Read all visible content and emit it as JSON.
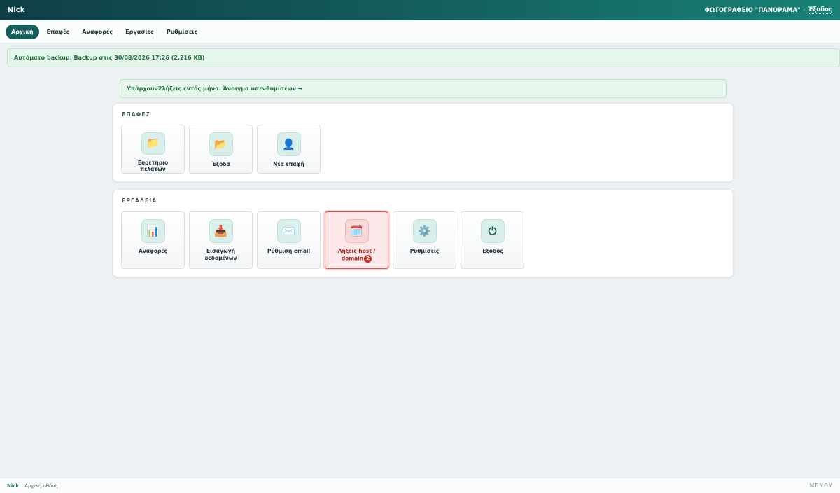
{
  "topbar": {
    "user": "Nick",
    "company": "ΦΩΤΟΓΡΑΦΕΙΟ \"ΠΑΝΟΡΑΜΑ\"",
    "separator": "·",
    "logout": "Έξοδος"
  },
  "nav": {
    "tabs": [
      {
        "label": "Αρχική",
        "active": true
      },
      {
        "label": "Επαφές"
      },
      {
        "label": "Αναφορές"
      },
      {
        "label": "Εργασίες"
      },
      {
        "label": "Ρυθμίσεις"
      }
    ]
  },
  "backup_notice": "Αυτόματο backup: Backup στις 30/08/2026 17:26 (2,216 KB)",
  "reminder": {
    "prefix": "Υπάρχουν ",
    "count": "2",
    "suffix": " λήξεις εντός μήνα. Άνοιγμα υπενθυμίσεων →"
  },
  "contacts": {
    "title": "ΕΠΑΦΕΣ",
    "tiles": [
      {
        "label": "Ευρετήριο πελατών",
        "icon": "📁",
        "icon_name": "folder-icon"
      },
      {
        "label": "Έξοδα",
        "icon": "📂",
        "icon_name": "open-folder-icon"
      },
      {
        "label": "Νέα επαφή",
        "icon": "👤",
        "icon_name": "user-icon"
      }
    ]
  },
  "tools": {
    "title": "ΕΡΓΑΛΕΙΑ",
    "tiles": [
      {
        "label": "Αναφορές",
        "icon": "📊",
        "icon_name": "bar-chart-icon"
      },
      {
        "label": "Εισαγωγή δεδομένων",
        "icon": "📥",
        "icon_name": "inbox-tray-icon"
      },
      {
        "label": "Ρύθμιση email",
        "icon": "✉️",
        "icon_name": "envelope-icon"
      },
      {
        "label": "Λήξεις host / domain",
        "icon": "🗓️",
        "icon_name": "calendar-icon",
        "badge": "2",
        "alert": true
      },
      {
        "label": "Ρυθμίσεις",
        "icon": "⚙️",
        "icon_name": "gear-icon"
      },
      {
        "label": "Έξοδος",
        "icon": "⏻",
        "icon_name": "power-icon"
      }
    ]
  },
  "statusbar": {
    "user": "Nick",
    "screen": "Αρχική οθόνη",
    "menu": "ΜΕΝΟΥ"
  }
}
